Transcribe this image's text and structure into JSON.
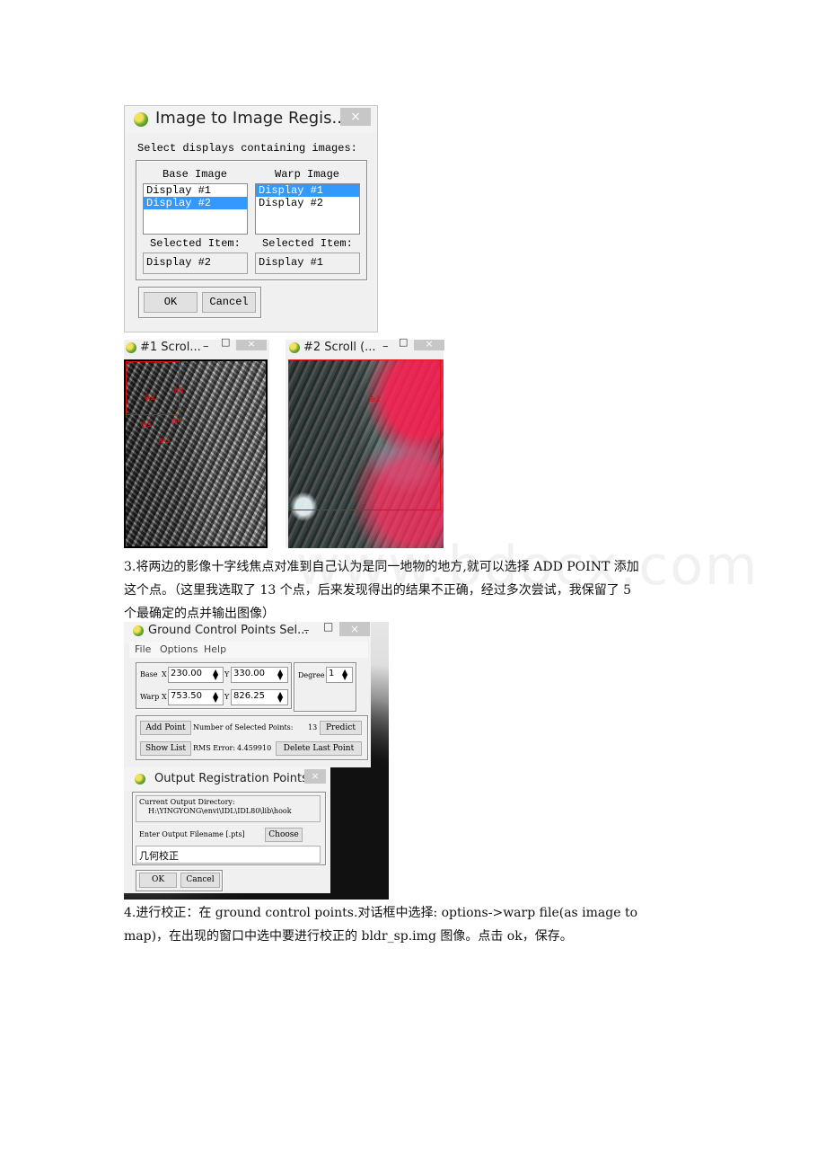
{
  "dialog_registration": {
    "title": "Image to Image Regis...",
    "close_icon": "×",
    "prompt": "Select displays containing images:",
    "base": {
      "header": "Base Image",
      "items": [
        "Display #1",
        "Display #2"
      ],
      "selected_index": 1,
      "selected_label": "Selected Item:",
      "selected_value": "Display #2"
    },
    "warp": {
      "header": "Warp Image",
      "items": [
        "Display #1",
        "Display #2"
      ],
      "selected_index": 0,
      "selected_label": "Selected Item:",
      "selected_value": "Display #1"
    },
    "ok_label": "OK",
    "cancel_label": "Cancel"
  },
  "scroll_windows": [
    {
      "title": "#1 Scrol...",
      "minimize": "–",
      "maximize": "□",
      "close": "×",
      "gcp_labels": [
        "1",
        "2",
        "3",
        "4",
        "5"
      ]
    },
    {
      "title": "#2 Scroll (...",
      "minimize": "–",
      "maximize": "□",
      "close": "×",
      "gcp_labels": [
        "2"
      ]
    }
  ],
  "paragraph3": {
    "lines": [
      "3.将两边的影像十字线焦点对准到自己认为是同一地物的地方,就可以选择 ADD POINT 添加",
      "这个点。（这里我选取了 13 个点，后来发现得出的结果不正确，经过多次尝试，我保留了 5",
      "个最确定的点并输出图像）"
    ]
  },
  "dialog_gcp": {
    "title": "Ground Control Points Sel...",
    "minimize": "–",
    "maximize": "□",
    "close": "×",
    "menu": [
      "File",
      "Options",
      "Help"
    ],
    "base_label": "Base",
    "warp_label": "Warp",
    "x_label": "X",
    "y_label": "Y",
    "base_x": "230.00",
    "base_y": "330.00",
    "warp_x": "753.50",
    "warp_y": "826.25",
    "degree_label": "Degree",
    "degree_value": "1",
    "add_point": "Add Point",
    "num_points_label": "Number of Selected Points:",
    "num_points_value": "13",
    "predict": "Predict",
    "show_list": "Show List",
    "rms_label": "RMS Error:",
    "rms_value": "4.459910",
    "delete_last": "Delete Last Point"
  },
  "dialog_output": {
    "title": "Output Registration Points",
    "close": "×",
    "dir_label": "Current Output Directory:",
    "dir_value": "H:\\YINGYONG\\envi\\IDL\\IDL80\\lib\\hook",
    "filename_label": "Enter Output Filename [.pts]",
    "choose": "Choose",
    "filename_value": "几何校正",
    "ok_label": "OK",
    "cancel_label": "Cancel"
  },
  "paragraph4": {
    "lines": [
      "4.进行校正：在 ground control points.对话框中选择: options->warp file(as image to",
      "map)，在出现的窗口中选中要进行校正的 bldr_sp.img 图像。点击 ok，保存。"
    ]
  },
  "watermark": "www.bdocx.com"
}
